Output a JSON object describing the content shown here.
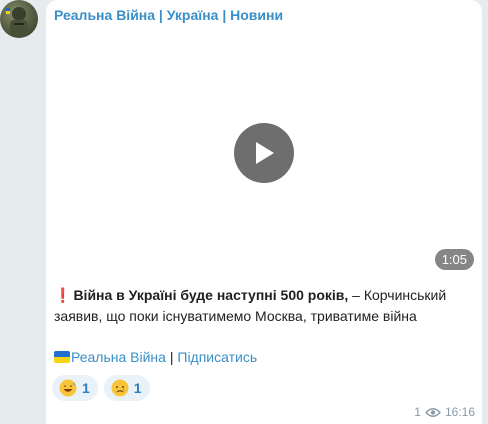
{
  "channel": {
    "name": "Реальна Війна | Україна | Новини"
  },
  "video": {
    "duration": "1:05"
  },
  "post": {
    "headline": "Війна в Україні буде наступні 500 років,",
    "body": " – Корчинський заявив, що поки існуватимемо Москва, триватиме війна",
    "channel_link": "Реальна Війна",
    "separator": " | ",
    "subscribe_link": "Підписатись"
  },
  "reactions": [
    {
      "emoji": "grinning-sweat",
      "count": "1"
    },
    {
      "emoji": "crying-face",
      "count": "1"
    }
  ],
  "meta": {
    "views": "1",
    "time": "16:16"
  },
  "colors": {
    "accent": "#3a8fc8",
    "background": "#e6ebee",
    "bubble": "#ffffff",
    "reaction_bg": "#e9f1f9"
  }
}
